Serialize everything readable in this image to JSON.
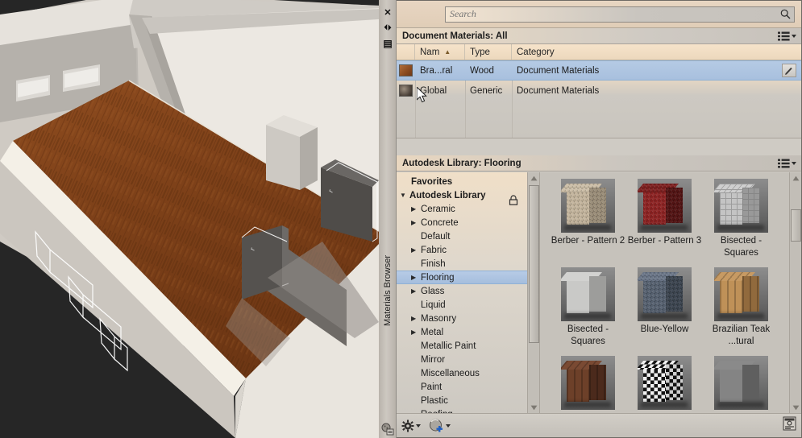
{
  "palette": {
    "vertical_title": "Materials Browser",
    "close_icon": "✕",
    "autohide_icon": "⏴⏵",
    "menu_icon": "▤",
    "browser_icon": "materials-browser-icon"
  },
  "search": {
    "placeholder": "Search",
    "value": "",
    "icon": "search-icon"
  },
  "document_materials": {
    "header": "Document Materials: All",
    "list_view_icon": "list-view-icon",
    "columns": [
      "",
      "Nam",
      "Type",
      "Category"
    ],
    "sort_column": "Nam",
    "sort_direction": "▲",
    "rows": [
      {
        "name": "Bra...ral",
        "type": "Wood",
        "category": "Document Materials",
        "selected": true,
        "swatch": "#9a5a2c",
        "edit_icon": "pencil-icon"
      },
      {
        "name": "Global",
        "type": "Generic",
        "category": "Document Materials",
        "selected": false,
        "swatch": "#6b5f52"
      }
    ]
  },
  "library": {
    "header": "Autodesk Library: Flooring",
    "list_view_icon": "list-view-icon",
    "lock_icon": "lock-icon",
    "tree": [
      {
        "label": "Favorites",
        "kind": "favorites",
        "expandable": false
      },
      {
        "label": "Autodesk Library",
        "kind": "root",
        "expandable": true,
        "expanded": true,
        "locked": true
      },
      {
        "label": "Ceramic",
        "kind": "child",
        "expandable": true
      },
      {
        "label": "Concrete",
        "kind": "child",
        "expandable": true
      },
      {
        "label": "Default",
        "kind": "child",
        "expandable": false
      },
      {
        "label": "Fabric",
        "kind": "child",
        "expandable": true
      },
      {
        "label": "Finish",
        "kind": "child",
        "expandable": false
      },
      {
        "label": "Flooring",
        "kind": "child",
        "expandable": true,
        "selected": true
      },
      {
        "label": "Glass",
        "kind": "child",
        "expandable": true
      },
      {
        "label": "Liquid",
        "kind": "child",
        "expandable": false
      },
      {
        "label": "Masonry",
        "kind": "child",
        "expandable": true
      },
      {
        "label": "Metal",
        "kind": "child",
        "expandable": true
      },
      {
        "label": "Metallic Paint",
        "kind": "child",
        "expandable": false
      },
      {
        "label": "Mirror",
        "kind": "child",
        "expandable": false
      },
      {
        "label": "Miscellaneous",
        "kind": "child",
        "expandable": false
      },
      {
        "label": "Paint",
        "kind": "child",
        "expandable": false
      },
      {
        "label": "Plastic",
        "kind": "child",
        "expandable": false
      },
      {
        "label": "Roofing",
        "kind": "child",
        "expandable": false
      }
    ],
    "materials": [
      {
        "name": "Berber - Pattern 2",
        "swatch_top": "#cbbda6",
        "swatch_left": "#c3b49c",
        "swatch_right": "#b3a48c",
        "texture": "weave"
      },
      {
        "name": "Berber - Pattern 3",
        "swatch_top": "#7d1f1f",
        "swatch_left": "#8d2222",
        "swatch_right": "#5f1616",
        "texture": "weave"
      },
      {
        "name": "Bisected - Squares",
        "swatch_top": "#cfcfcf",
        "swatch_left": "#c4c4c4",
        "swatch_right": "#b2b2b2",
        "texture": "grid"
      },
      {
        "name": "Bisected - Squares",
        "swatch_top": "#d2d2d0",
        "swatch_left": "#c9c9c7",
        "swatch_right": "#b6b6b4",
        "texture": "plain"
      },
      {
        "name": "Blue-Yellow",
        "swatch_top": "#6a7587",
        "swatch_left": "#55606f",
        "swatch_right": "#454f5c",
        "texture": "weave"
      },
      {
        "name": "Brazilian Teak ...tural",
        "swatch_top": "#c79a63",
        "swatch_left": "#bf9158",
        "swatch_right": "#a97b47",
        "texture": "wood"
      },
      {
        "name": "",
        "swatch_top": "#7a4a33",
        "swatch_left": "#6d4029",
        "swatch_right": "#573120",
        "texture": "wood"
      },
      {
        "name": "",
        "swatch_top": "#cfcfcf",
        "swatch_left": "#d8d8d8",
        "swatch_right": "#bdbdbd",
        "texture": "checker"
      },
      {
        "name": "",
        "swatch_top": "#8a8a8a",
        "swatch_left": "#848484",
        "swatch_right": "#6e6e6e",
        "texture": "plain"
      }
    ]
  },
  "bottom_toolbar": {
    "settings_icon": "gear-icon",
    "settings_caret": "▾",
    "new_material_icon": "new-material-sphere-icon",
    "new_material_caret": "▾",
    "editor_icon": "material-editor-icon"
  },
  "viewport": {
    "floor_material_color": "#8a4a1e",
    "wall_color": "#d8d4cf",
    "background_color": "#262626"
  }
}
